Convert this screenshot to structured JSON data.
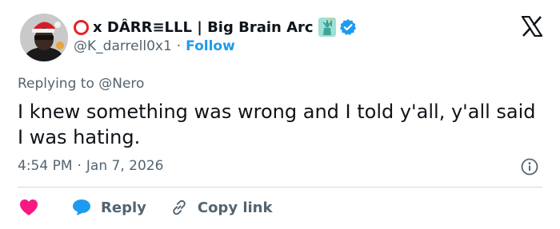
{
  "author": {
    "display_name": "x DÂRR≡LLL | Big Brain Arc",
    "handle": "@K_darrell0x1",
    "separator": "·",
    "follow_label": "Follow"
  },
  "reply": {
    "prefix": "Replying to",
    "mention": "@Nero"
  },
  "tweet": {
    "text": "I knew something was wrong and I told y'all, y'all said I was hating."
  },
  "meta": {
    "time": "4:54 PM",
    "separator": "·",
    "date": "Jan 7, 2026"
  },
  "actions": {
    "reply_label": "Reply",
    "copy_link_label": "Copy link"
  },
  "colors": {
    "accent": "#1d9bf0",
    "like": "#f91880",
    "secondary_text": "#536471",
    "primary_text": "#0f1419"
  }
}
